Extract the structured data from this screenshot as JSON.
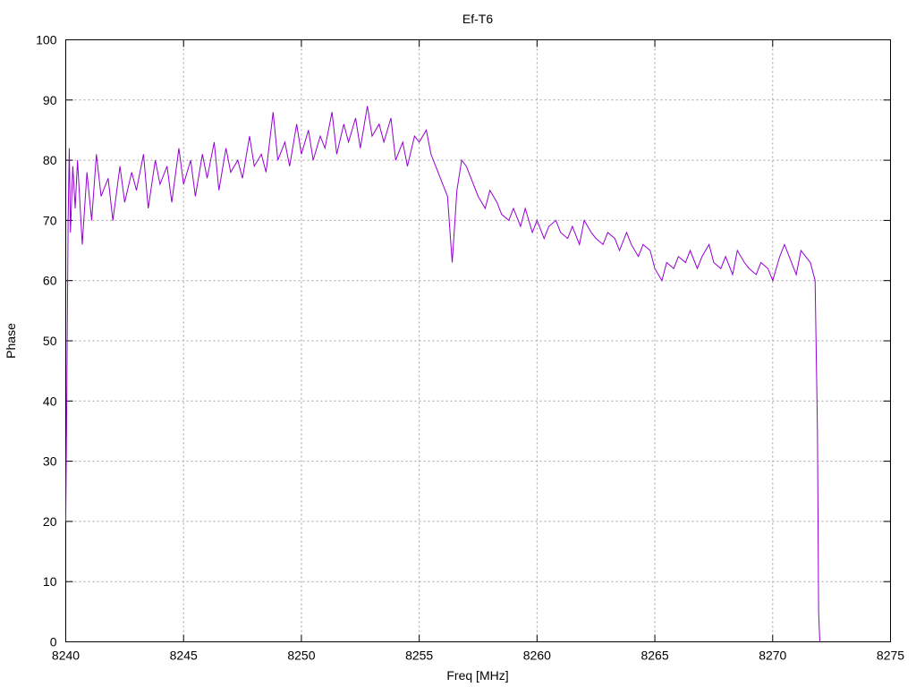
{
  "chart_data": {
    "type": "line",
    "title": "Ef-T6",
    "xlabel": "Freq [MHz]",
    "ylabel": "Phase",
    "xlim": [
      8240,
      8275
    ],
    "ylim": [
      0,
      100
    ],
    "xticks": [
      8240,
      8245,
      8250,
      8255,
      8260,
      8265,
      8270,
      8275
    ],
    "yticks": [
      0,
      10,
      20,
      30,
      40,
      50,
      60,
      70,
      80,
      90,
      100
    ],
    "grid": true,
    "legend": "none",
    "series": [
      {
        "color": "#9400d3",
        "x": [
          8240.0,
          8240.05,
          8240.1,
          8240.15,
          8240.2,
          8240.3,
          8240.4,
          8240.5,
          8240.7,
          8240.9,
          8241.1,
          8241.3,
          8241.5,
          8241.8,
          8242.0,
          8242.3,
          8242.5,
          8242.8,
          8243.0,
          8243.3,
          8243.5,
          8243.8,
          8244.0,
          8244.3,
          8244.5,
          8244.8,
          8245.0,
          8245.3,
          8245.5,
          8245.8,
          8246.0,
          8246.3,
          8246.5,
          8246.8,
          8247.0,
          8247.3,
          8247.5,
          8247.8,
          8248.0,
          8248.3,
          8248.5,
          8248.8,
          8249.0,
          8249.3,
          8249.5,
          8249.8,
          8250.0,
          8250.3,
          8250.5,
          8250.8,
          8251.0,
          8251.3,
          8251.5,
          8251.8,
          8252.0,
          8252.3,
          8252.5,
          8252.8,
          8253.0,
          8253.3,
          8253.5,
          8253.8,
          8254.0,
          8254.3,
          8254.5,
          8254.8,
          8255.0,
          8255.3,
          8255.5,
          8255.8,
          8256.0,
          8256.2,
          8256.4,
          8256.6,
          8256.8,
          8257.0,
          8257.3,
          8257.5,
          8257.8,
          8258.0,
          8258.3,
          8258.5,
          8258.8,
          8259.0,
          8259.3,
          8259.5,
          8259.8,
          8260.0,
          8260.3,
          8260.5,
          8260.8,
          8261.0,
          8261.3,
          8261.5,
          8261.8,
          8262.0,
          8262.3,
          8262.5,
          8262.8,
          8263.0,
          8263.3,
          8263.5,
          8263.8,
          8264.0,
          8264.3,
          8264.5,
          8264.8,
          8265.0,
          8265.3,
          8265.5,
          8265.8,
          8266.0,
          8266.3,
          8266.5,
          8266.8,
          8267.0,
          8267.3,
          8267.5,
          8267.8,
          8268.0,
          8268.3,
          8268.5,
          8268.8,
          8269.0,
          8269.3,
          8269.5,
          8269.8,
          8270.0,
          8270.3,
          8270.5,
          8270.8,
          8271.0,
          8271.2,
          8271.4,
          8271.6,
          8271.8,
          8271.9,
          8271.95,
          8272.0
        ],
        "y": [
          20,
          44,
          70,
          82,
          68,
          79,
          72,
          80,
          66,
          78,
          70,
          81,
          74,
          77,
          70,
          79,
          73,
          78,
          75,
          81,
          72,
          80,
          76,
          79,
          73,
          82,
          76,
          80,
          74,
          81,
          77,
          83,
          75,
          82,
          78,
          80,
          77,
          84,
          79,
          81,
          78,
          88,
          80,
          83,
          79,
          86,
          81,
          85,
          80,
          84,
          82,
          88,
          81,
          86,
          83,
          87,
          82,
          89,
          84,
          86,
          83,
          87,
          80,
          83,
          79,
          84,
          83,
          85,
          81,
          78,
          76,
          74,
          63,
          75,
          80,
          79,
          76,
          74,
          72,
          75,
          73,
          71,
          70,
          72,
          69,
          72,
          68,
          70,
          67,
          69,
          70,
          68,
          67,
          69,
          66,
          70,
          68,
          67,
          66,
          68,
          67,
          65,
          68,
          66,
          64,
          66,
          65,
          62,
          60,
          63,
          62,
          64,
          63,
          65,
          62,
          64,
          66,
          63,
          62,
          64,
          61,
          65,
          63,
          62,
          61,
          63,
          62,
          60,
          64,
          66,
          63,
          61,
          65,
          64,
          63,
          60,
          35,
          5,
          0
        ]
      }
    ]
  }
}
